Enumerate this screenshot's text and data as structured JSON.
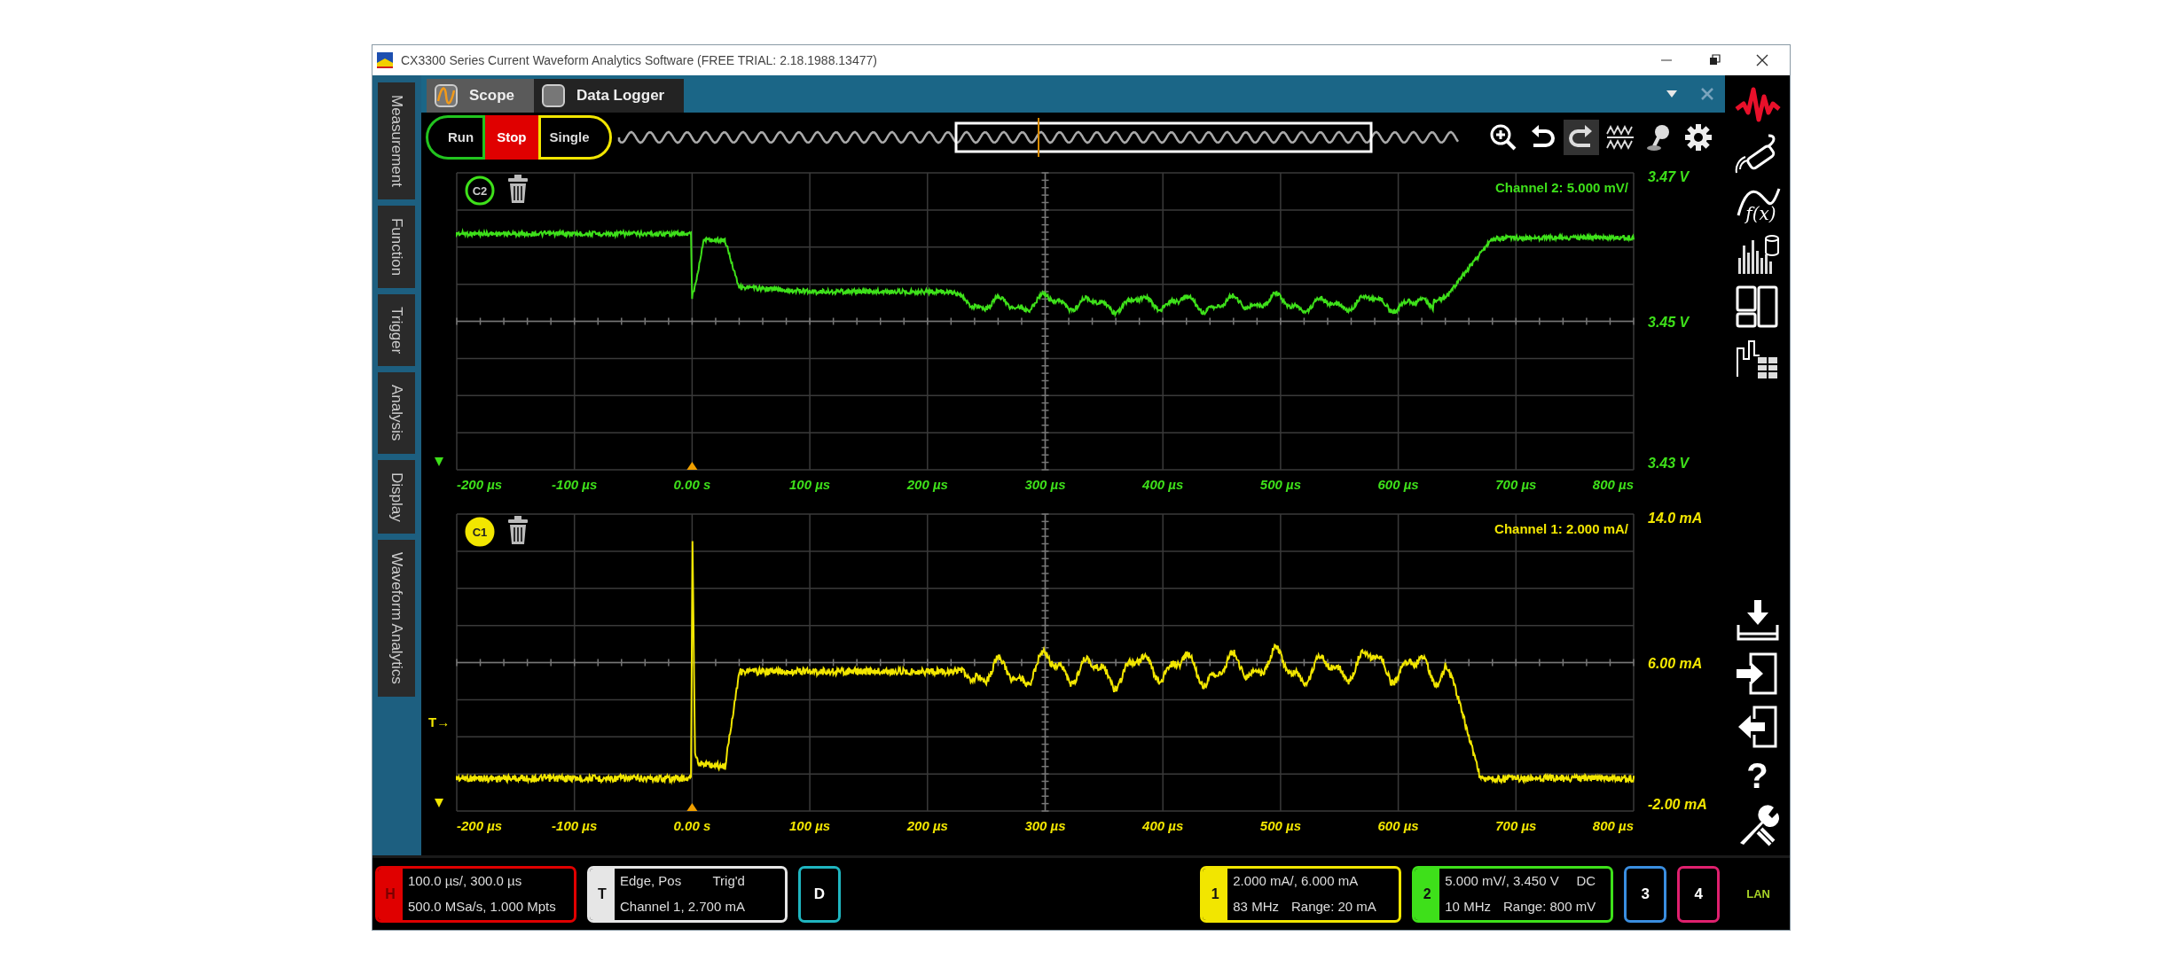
{
  "window": {
    "title": "CX3300 Series Current Waveform Analytics Software (FREE TRIAL: 2.18.1988.13477)"
  },
  "sidebar": {
    "items": [
      {
        "label": "Measurement"
      },
      {
        "label": "Function"
      },
      {
        "label": "Trigger"
      },
      {
        "label": "Analysis"
      },
      {
        "label": "Display"
      },
      {
        "label": "Waveform Analytics"
      }
    ]
  },
  "tabs": [
    {
      "label": "Scope",
      "selected": true
    },
    {
      "label": "Data Logger",
      "selected": false
    }
  ],
  "run_controls": [
    {
      "label": "Run",
      "selected": false,
      "color": "#22c41f"
    },
    {
      "label": "Stop",
      "selected": true,
      "color": "#e00000"
    },
    {
      "label": "Single",
      "selected": false,
      "color": "#f2e600"
    }
  ],
  "plots": [
    {
      "badge": "C2",
      "badge_selected": false,
      "color": "#3ee01a",
      "title": "Channel 2:  5.000 mV/",
      "y_labels": [
        "3.47 V",
        "3.45 V",
        "3.43 V"
      ],
      "x_labels": [
        "-200 µs",
        "-100 µs",
        "0.00 s",
        "100 µs",
        "200 µs",
        "300 µs",
        "400 µs",
        "500 µs",
        "600 µs",
        "700 µs",
        "800 µs"
      ]
    },
    {
      "badge": "C1",
      "badge_selected": true,
      "color": "#f2e600",
      "title": "Channel 1:  2.000 mA/",
      "trigger_marker": "T→",
      "y_labels": [
        "14.0 mA",
        "6.00 mA",
        "-2.00 mA"
      ],
      "x_labels": [
        "-200 µs",
        "-100 µs",
        "0.00 s",
        "100 µs",
        "200 µs",
        "300 µs",
        "400 µs",
        "500 µs",
        "600 µs",
        "700 µs",
        "800 µs"
      ]
    }
  ],
  "right_toolbar": {
    "function_label": "f(x)",
    "help_label": "?"
  },
  "status_bar": {
    "items": [
      {
        "kind": "horizontal",
        "label": "H",
        "color": "#e00000",
        "line1": "100.0 µs/, 300.0 µs",
        "line2": "500.0 MSa/s, 1.000 Mpts"
      },
      {
        "kind": "trigger",
        "label": "T",
        "color": "#e6e6e6",
        "line1": "Edge, Pos",
        "status": "Trig'd",
        "line2": "Channel 1, 2.700 mA"
      },
      {
        "kind": "button",
        "label": "D",
        "color": "#1fb5c0"
      },
      {
        "kind": "channel",
        "label": "1",
        "color": "#f2e600",
        "line1": "2.000 mA/, 6.000 mA",
        "bandwidth": "83 MHz",
        "range": "Range: 20 mA"
      },
      {
        "kind": "channel",
        "label": "2",
        "color": "#3ee01a",
        "line1": "5.000 mV/, 3.450 V",
        "coupling": "DC",
        "bandwidth": "10 MHz",
        "range": "Range: 800 mV"
      },
      {
        "kind": "button",
        "label": "3",
        "color": "#3a8ee0"
      },
      {
        "kind": "button",
        "label": "4",
        "color": "#e0206e"
      }
    ],
    "connection": "LAN"
  }
}
